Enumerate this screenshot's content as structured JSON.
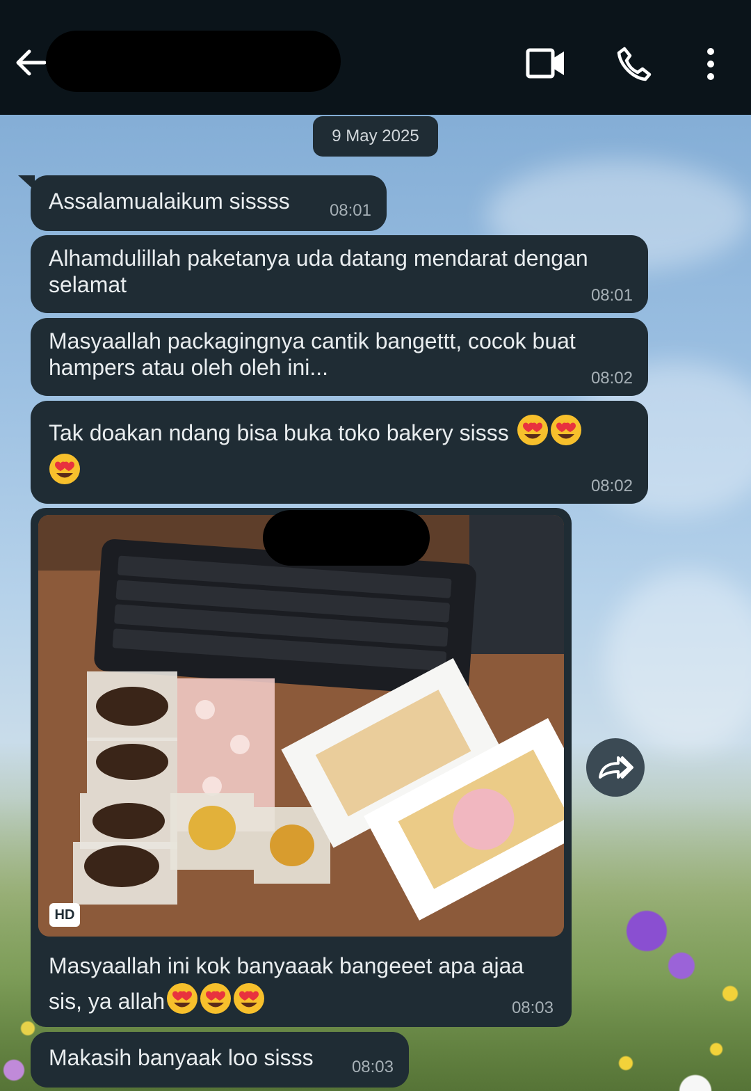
{
  "header": {
    "back_icon": "arrow-left-icon",
    "video_icon": "video-call-icon",
    "phone_icon": "phone-icon",
    "menu_icon": "more-vertical-icon"
  },
  "date_chip": "9 May 2025",
  "messages": [
    {
      "text": "Assalamualaikum sissss",
      "time": "08:01"
    },
    {
      "text": "Alhamdulillah paketanya uda datang mendarat dengan selamat",
      "time": "08:01"
    },
    {
      "text": "Masyaallah packagingnya cantik bangettt, cocok buat hampers atau oleh oleh ini...",
      "time": "08:02"
    },
    {
      "text": "Tak doakan ndang bisa buka toko bakery sisss",
      "time": "08:02"
    },
    {
      "text": "Masyaallah ini kok banyaaak bangeeet apa ajaa sis, ya allah",
      "time": "08:03",
      "image_badge": "HD"
    },
    {
      "text": "Makasih banyaak loo sisss",
      "time": "08:03"
    }
  ],
  "colors": {
    "bubble": "#1f2c34",
    "header": "#0b141a",
    "text": "#e9edef"
  }
}
